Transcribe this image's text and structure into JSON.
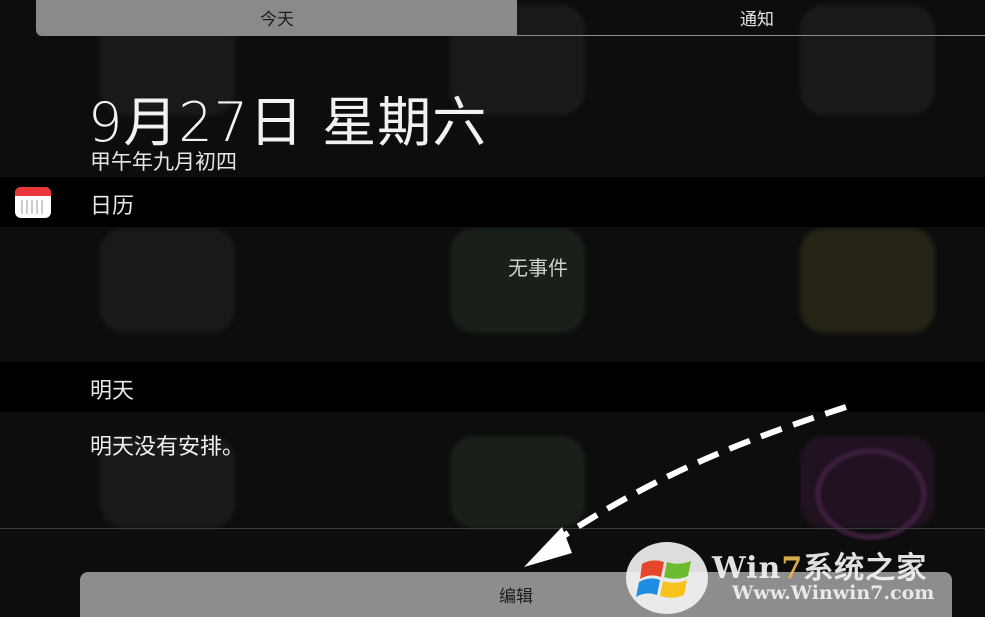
{
  "tabs": [
    {
      "label": "今天",
      "active": true
    },
    {
      "label": "通知",
      "active": false
    }
  ],
  "today": {
    "date": "9月27日 星期六",
    "lunar_date": "甲午年九月初四"
  },
  "calendar": {
    "title": "日历",
    "empty_text": "无事件",
    "icon": "calendar-icon"
  },
  "tomorrow": {
    "title": "明天",
    "text": "明天没有安排。"
  },
  "footer": {
    "edit_label": "编辑"
  },
  "watermark": {
    "brand_win": "Win",
    "brand_7": "7",
    "brand_suffix": "系统之家",
    "url": "Www.Winwin7.com"
  },
  "colors": {
    "background": "#0d0d0d",
    "segment_active": "#8a8a8a",
    "band": "#000000",
    "calendar_icon_red": "#e8363a",
    "edit_button": "#8d8d8d"
  }
}
